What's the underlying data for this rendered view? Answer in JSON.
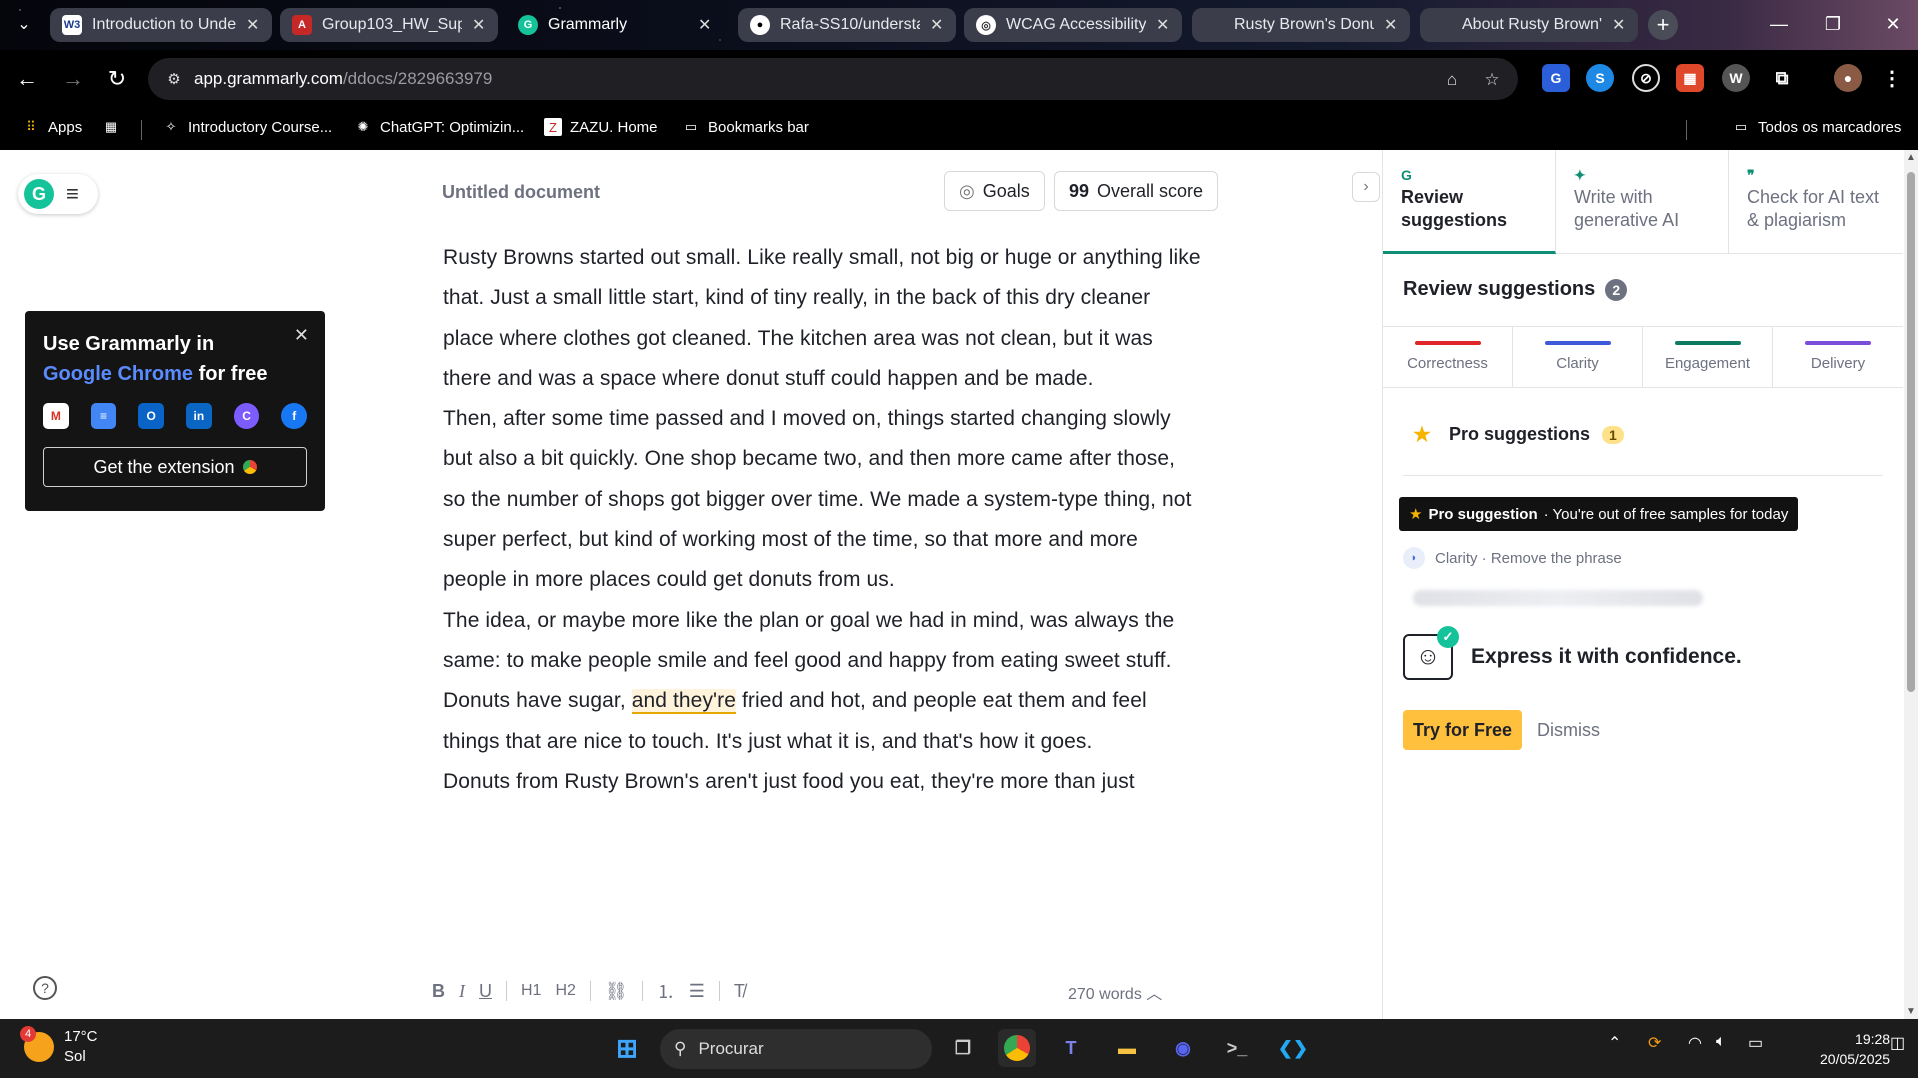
{
  "browser": {
    "tabs": [
      {
        "title": "Introduction to Unde",
        "fav": "W3"
      },
      {
        "title": "Group103_HW_Supp",
        "fav": "A"
      },
      {
        "title": "Grammarly",
        "fav": "G"
      },
      {
        "title": "Rafa-SS10/understa",
        "fav": "●"
      },
      {
        "title": "WCAG Accessibility",
        "fav": "◎"
      },
      {
        "title": "Rusty Brown's Donut",
        "fav": ""
      },
      {
        "title": "About Rusty Brown's",
        "fav": ""
      }
    ],
    "close_glyph": "✕",
    "url_host": "app.grammarly.com",
    "url_path": "/ddocs/2829663979"
  },
  "bookmarks": {
    "apps": "Apps",
    "items": [
      "Introductory Course...",
      "ChatGPT: Optimizin...",
      "ZAZU. Home",
      "Bookmarks bar"
    ],
    "all": "Todos os marcadores"
  },
  "editor": {
    "doc_title": "Untitled document",
    "goals_label": "Goals",
    "score_value": "99",
    "score_label": "Overall score",
    "paragraphs": {
      "p1": "Rusty Browns started out small. Like really small, not big or huge or anything like that. Just a small little start, kind of tiny really, in the back of this dry cleaner place where clothes got cleaned. The kitchen area was not clean, but it was there and was a space where donut stuff could happen and be made.",
      "p2": "Then, after some time passed and I moved on, things started changing slowly but also a bit quickly. One shop became two, and then more came after those, so the number of shops got bigger over time. We made a system-type thing, not super perfect, but kind of working most of the time, so that more and more people in more places could get donuts from us.",
      "p3_before": "The idea, or maybe more like the plan or goal we had in mind, was always the same: to make people smile and feel good and happy from eating sweet stuff. Donuts have sugar, ",
      "p3_mark": "and they're",
      "p3_after": " fried and hot, and people eat them and feel things that are nice to touch. It's just what it is, and that's how it goes.",
      "p4": "Donuts from Rusty Brown's aren't just food you eat, they're more than just"
    },
    "word_count": "270 words"
  },
  "promo": {
    "line1": "Use Grammarly in",
    "highlight": "Google Chrome",
    "line2_rest": " for free",
    "cta": "Get the extension"
  },
  "sidebar": {
    "tabs": [
      {
        "label": "Review suggestions"
      },
      {
        "label": "Write with generative AI"
      },
      {
        "label": "Check for AI text & plagiarism"
      }
    ],
    "title": "Review suggestions",
    "count": "2",
    "categories": [
      {
        "label": "Correctness",
        "color": "#e0262b"
      },
      {
        "label": "Clarity",
        "color": "#3d5bd9"
      },
      {
        "label": "Engagement",
        "color": "#0e7a5f"
      },
      {
        "label": "Delivery",
        "color": "#7a4ddb"
      }
    ],
    "pro_title": "Pro suggestions",
    "pro_count": "1",
    "banner_bold": "Pro suggestion",
    "banner_text": "· You're out of free samples for today",
    "clarity_text": "Clarity · Remove the phrase",
    "express": "Express it with confidence.",
    "try_label": "Try for Free",
    "dismiss_label": "Dismiss"
  },
  "taskbar": {
    "temp": "17°C",
    "condition": "Sol",
    "weather_badge": "4",
    "search_placeholder": "Procurar",
    "time": "19:28",
    "date": "20/05/2025"
  }
}
